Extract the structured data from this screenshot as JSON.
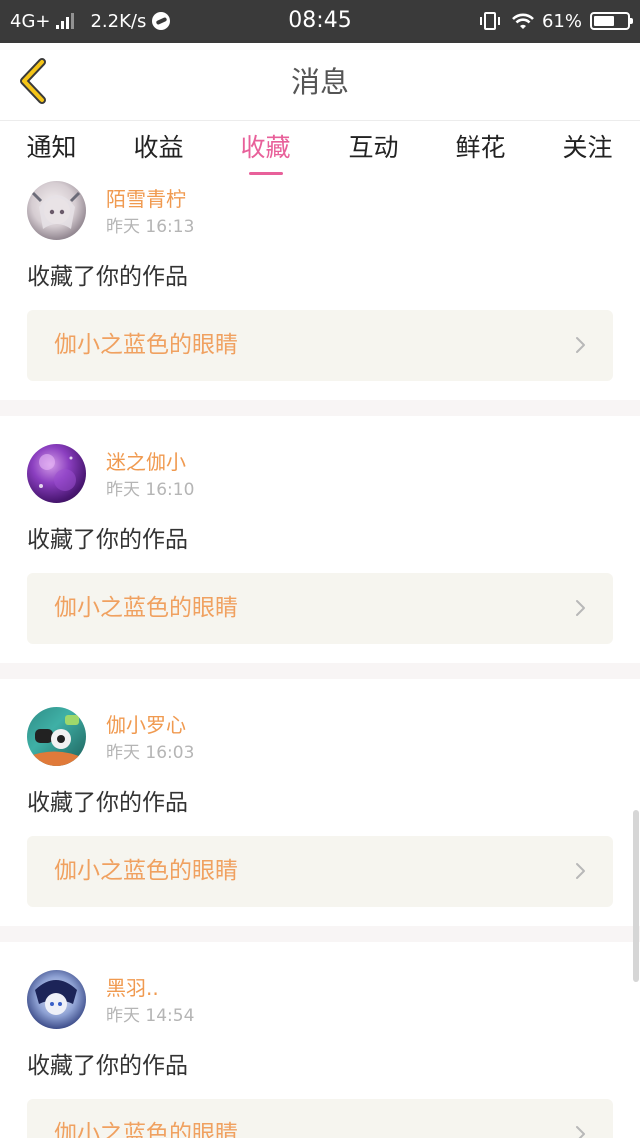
{
  "status_bar": {
    "network": "4G+",
    "speed": "2.2K/s",
    "time": "08:45",
    "battery": "61%",
    "battery_level": 0.61,
    "icons": [
      "signal-icon",
      "app-bubble-icon",
      "vibrate-icon",
      "wifi-icon",
      "battery-icon"
    ]
  },
  "header": {
    "title": "消息",
    "back_icon": "chevron-left-icon",
    "accent_color": "#f5c518"
  },
  "tabs": {
    "items": [
      {
        "label": "通知"
      },
      {
        "label": "收益"
      },
      {
        "label": "收藏"
      },
      {
        "label": "互动"
      },
      {
        "label": "鲜花"
      },
      {
        "label": "关注"
      }
    ],
    "active": "收藏",
    "active_color": "#e8609a"
  },
  "feed": {
    "items": [
      {
        "username": "陌雪青柠",
        "time": "昨天 16:13",
        "action": "收藏了你的作品",
        "work": "伽小之蓝色的眼睛"
      },
      {
        "username": "迷之伽小",
        "time": "昨天 16:10",
        "action": "收藏了你的作品",
        "work": "伽小之蓝色的眼睛"
      },
      {
        "username": "伽小罗心",
        "time": "昨天 16:03",
        "action": "收藏了你的作品",
        "work": "伽小之蓝色的眼睛"
      },
      {
        "username": "黑羽..",
        "time": "昨天 14:54",
        "action": "收藏了你的作品",
        "work": "伽小之蓝色的眼睛"
      }
    ],
    "username_color": "#f09a50",
    "work_color": "#f0a160"
  }
}
